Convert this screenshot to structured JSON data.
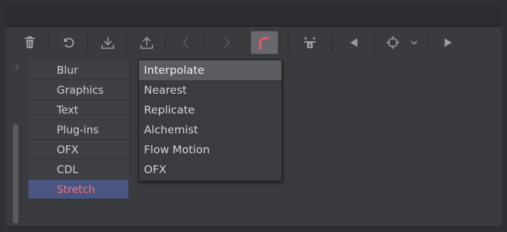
{
  "toolbar": {
    "buttons": [
      {
        "icon": "trash-icon"
      },
      {
        "icon": "reset-icon"
      },
      {
        "icon": "download-icon"
      },
      {
        "icon": "upload-icon"
      },
      {
        "icon": "chevron-left-icon"
      },
      {
        "icon": "chevron-right-icon"
      },
      {
        "icon": "curve-tool-icon",
        "active": true,
        "color": "#ff5a5a"
      },
      {
        "icon": "transform-icon"
      },
      {
        "icon": "previous-keyframe-icon"
      },
      {
        "icon": "keyframe-target-icon"
      },
      {
        "icon": "chevron-down-icon"
      },
      {
        "icon": "next-keyframe-icon"
      }
    ]
  },
  "list": {
    "items": [
      {
        "label": "Blur"
      },
      {
        "label": "Graphics"
      },
      {
        "label": "Text"
      },
      {
        "label": "Plug-ins"
      },
      {
        "label": "OFX"
      },
      {
        "label": "CDL"
      },
      {
        "label": "Stretch",
        "selected": true
      }
    ]
  },
  "dropdown": {
    "items": [
      {
        "label": "Interpolate",
        "highlighted": true
      },
      {
        "label": "Nearest"
      },
      {
        "label": "Replicate"
      },
      {
        "label": "Alchemist"
      },
      {
        "label": "Flow Motion"
      },
      {
        "label": "OFX"
      }
    ]
  },
  "colors": {
    "accent_selected_bg": "#4a5582",
    "accent_selected_text": "#ff6f6f",
    "active_tool": "#ff5a5a"
  }
}
